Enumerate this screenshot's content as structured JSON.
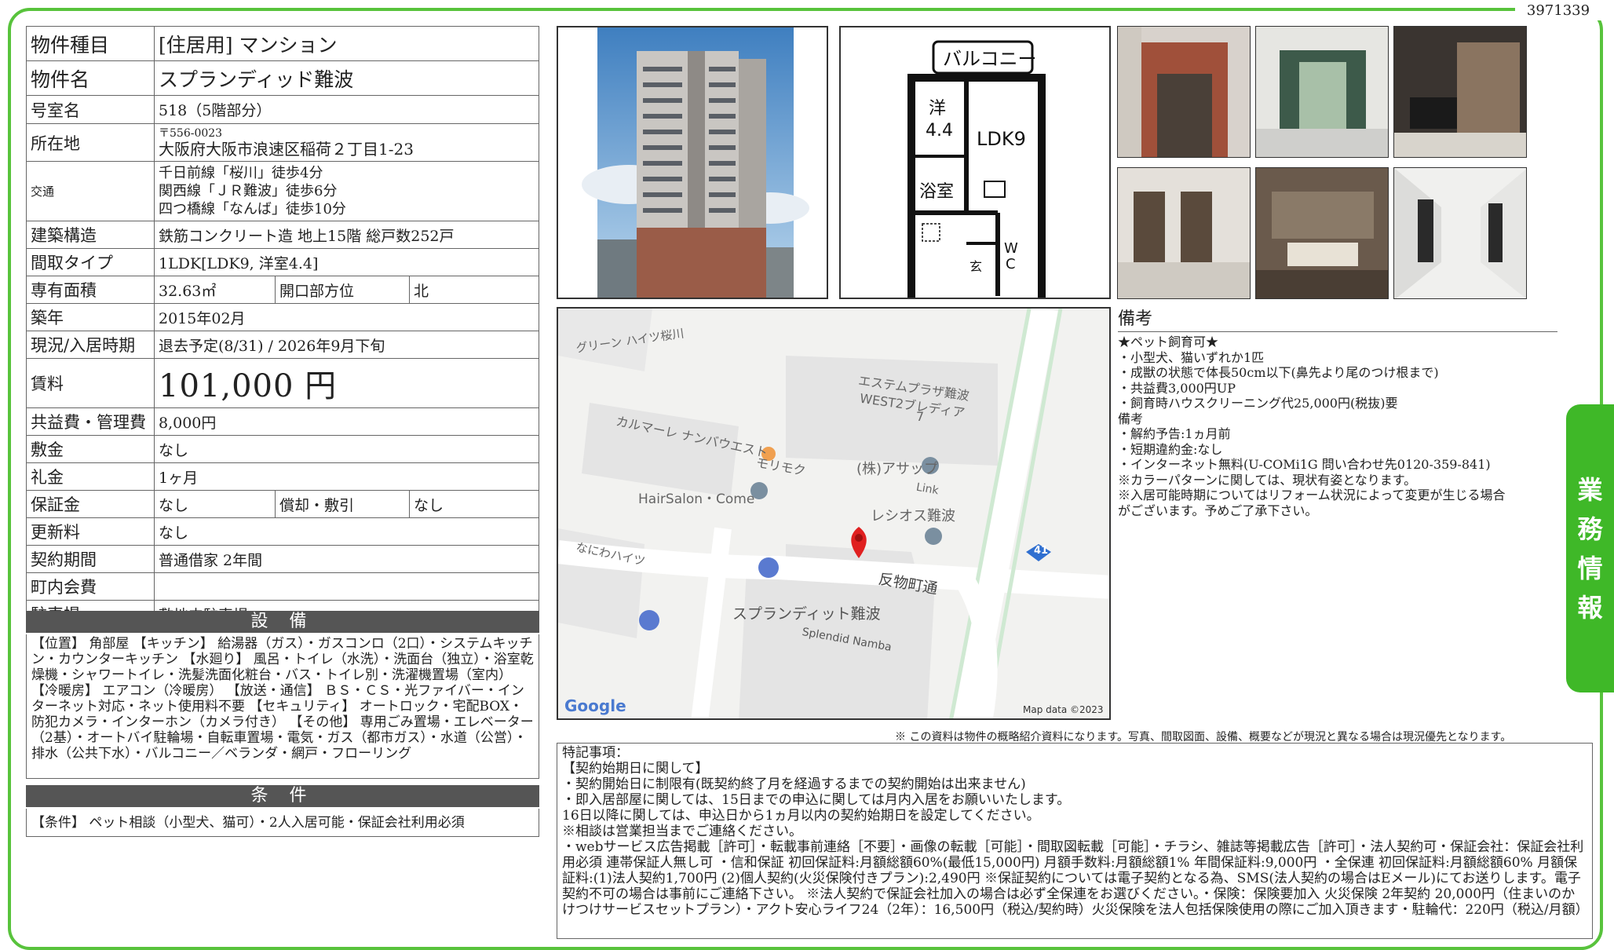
{
  "doc_id": "3971339",
  "spec": {
    "type_label": "物件種目",
    "type_value": "[住居用] マンション",
    "name_label": "物件名",
    "name_value": "スプランディッド難波",
    "room_label": "号室名",
    "room_value": "518（5階部分）",
    "location_label": "所在地",
    "zip": "〒556-0023",
    "address": "大阪府大阪市浪速区稲荷２丁目1-23",
    "traffic_label": "交通",
    "traffic": [
      "千日前線「桜川」徒歩4分",
      "関西線「ＪＲ難波」徒歩6分",
      "四つ橋線「なんば」徒歩10分"
    ],
    "structure_label": "建築構造",
    "structure_value": "鉄筋コンクリート造 地上15階 総戸数252戸",
    "layout_label": "間取タイプ",
    "layout_value": "1LDK[LDK9, 洋室4.4]",
    "area_label": "専有面積",
    "area_value": "32.63㎡",
    "facing_label": "開口部方位",
    "facing_value": "北",
    "built_label": "築年",
    "built_value": "2015年02月",
    "status_label": "現況/入居時期",
    "status_value": "退去予定(8/31) / 2026年9月下旬",
    "rent_label": "賃料",
    "rent_value": "101,000 円",
    "fee_label": "共益費・管理費",
    "fee_value": "8,000円",
    "deposit_label": "敷金",
    "deposit_value": "なし",
    "key_money_label": "礼金",
    "key_money_value": "1ヶ月",
    "guarantee_label": "保証金",
    "guarantee_value": "なし",
    "amort_label": "償却・敷引",
    "amort_value": "なし",
    "renewal_label": "更新料",
    "renewal_value": "なし",
    "contract_label": "契約期間",
    "contract_value": "普通借家 2年間",
    "town_label": "町内会費",
    "town_value": "",
    "parking_label": "駐車場",
    "parking_value": "敷地内駐車場"
  },
  "setsubi": {
    "title": "設 備",
    "text": "【位置】 角部屋 【キッチン】 給湯器（ガス）・ガスコンロ（2口）・システムキッチン・カウンターキッチン 【水廻り】 風呂・トイレ（水洗）・洗面台（独立）・浴室乾燥機・シャワートイレ・洗髪洗面化粧台・バス・トイレ別・洗濯機置場（室内） 【冷暖房】 エアコン（冷暖房） 【放送・通信】 ＢＳ・ＣＳ・光ファイバー・インターネット対応・ネット使用料不要 【セキュリティ】 オートロック・宅配BOX・防犯カメラ・インターホン（カメラ付き） 【その他】 専用ごみ置場・エレベーター（2基）・オートバイ駐輪場・自転車置場・電気・ガス（都市ガス）・水道（公営）・排水（公共下水）・バルコニー／ベランダ・網戸・フローリング"
  },
  "joken": {
    "title": "条 件",
    "text": "【条件】 ペット相談（小型犬、猫可）・2人入居可能・保証会社利用必須"
  },
  "floorplan": {
    "balcony": "バルコニー",
    "western": "洋",
    "western_size": "4.4",
    "ldk": "LDK9",
    "bath": "浴室",
    "wc1": "W",
    "wc2": "C",
    "entrance": "玄"
  },
  "map": {
    "labels": {
      "green_heights": "グリーン ハイツ桜川",
      "estem1": "エステムプラザ難波",
      "estem2": "WEST2ブレディア",
      "estem_num": "7",
      "carmare": "カルマーレ ナンバウエスト",
      "morimoku": "モリモク",
      "asap": "(株)アサップ",
      "link": "Link",
      "hairsalon": "HairSalon・Come",
      "reshios": "レシオス難波",
      "naniwa": "なにわハイツ",
      "street": "反物町通",
      "route": "41",
      "building_jp": "スプランディット難波",
      "building_en": "Splendid Namba",
      "google": "Google",
      "mapdata": "Map data ©2023"
    },
    "colors": {
      "bg": "#f2f2f0",
      "road": "#ffffff",
      "block": "#e4e4e4",
      "pin": "#e02020",
      "poi": "#7a8fa0",
      "route": "#2f6fd0",
      "green": "#cfe9d2"
    }
  },
  "bikou": {
    "title": "備考",
    "lines": [
      "★ペット飼育可★",
      "・小型犬、猫いずれか1匹",
      "・成獣の状態で体長50cm以下(鼻先より尾のつけ根まで)",
      "・共益費3,000円UP",
      "・飼育時ハウスクリーニング代25,000円(税抜)要",
      "備考",
      "・解約予告:1ヵ月前",
      "・短期違約金:なし",
      "・インターネット無料(U-COMi1G 問い合わせ先0120-359-841)",
      "※カラーパターンに関しては、現状有姿となります。",
      "※入居可能時期についてはリフォーム状況によって変更が生じる場合",
      "がございます。予めご了承下さい。"
    ]
  },
  "disclaimer": "※ この資料は物件の概略紹介資料になります。写真、間取図面、設備、概要などが現況と異なる場合は現況優先となります。",
  "tokki": {
    "lines": [
      "特記事項：",
      "【契約始期日に関して】",
      "・契約開始日に制限有(既契約終了月を経過するまでの契約開始は出来ません)",
      "・即入居部屋に関しては、15日までの申込に関しては月内入居をお願いいたします。",
      "16日以降に関しては、申込日から1ヵ月以内の契約始期日を設定してください。",
      "※相談は営業担当までご連絡ください。"
    ],
    "paragraph": "・webサービス広告掲載［許可］・転載事前連絡［不要］・画像の転載［可能］・間取図転載［可能］・チラシ、雑誌等掲載広告［許可］・法人契約可・保証会社：保証会社利用必須 連帯保証人無し可 ・信和保証 初回保証料:月額総額60%(最低15,000円) 月額手数料:月額総額1% 年間保証料:9,000円 ・全保連 初回保証料:月額総額60% 月額保証料:(1)法人契約1,700円 (2)個人契約(火災保険付きプラン):2,490円 ※保証契約については電子契約となる為、SMS(法人契約の場合はEメール)にてお送りします。電子契約不可の場合は事前にご連絡下さい。 ※法人契約で保証会社加入の場合は必ず全保連をお選びください。・保険：保険要加入 火災保険 2年契約 20,000円（住まいのかけつけサービスセットプラン）・アクト安心ライフ24（2年）：16,500円（税込/契約時）火災保険を法人包括保険使用の際にご加入頂きます・駐輪代：220円（税込/月額）"
  },
  "side_tab": [
    "業",
    "務",
    "情",
    "報"
  ],
  "colors": {
    "frame": "#58c33c",
    "tab": "#3fb828",
    "section": "#555555"
  }
}
